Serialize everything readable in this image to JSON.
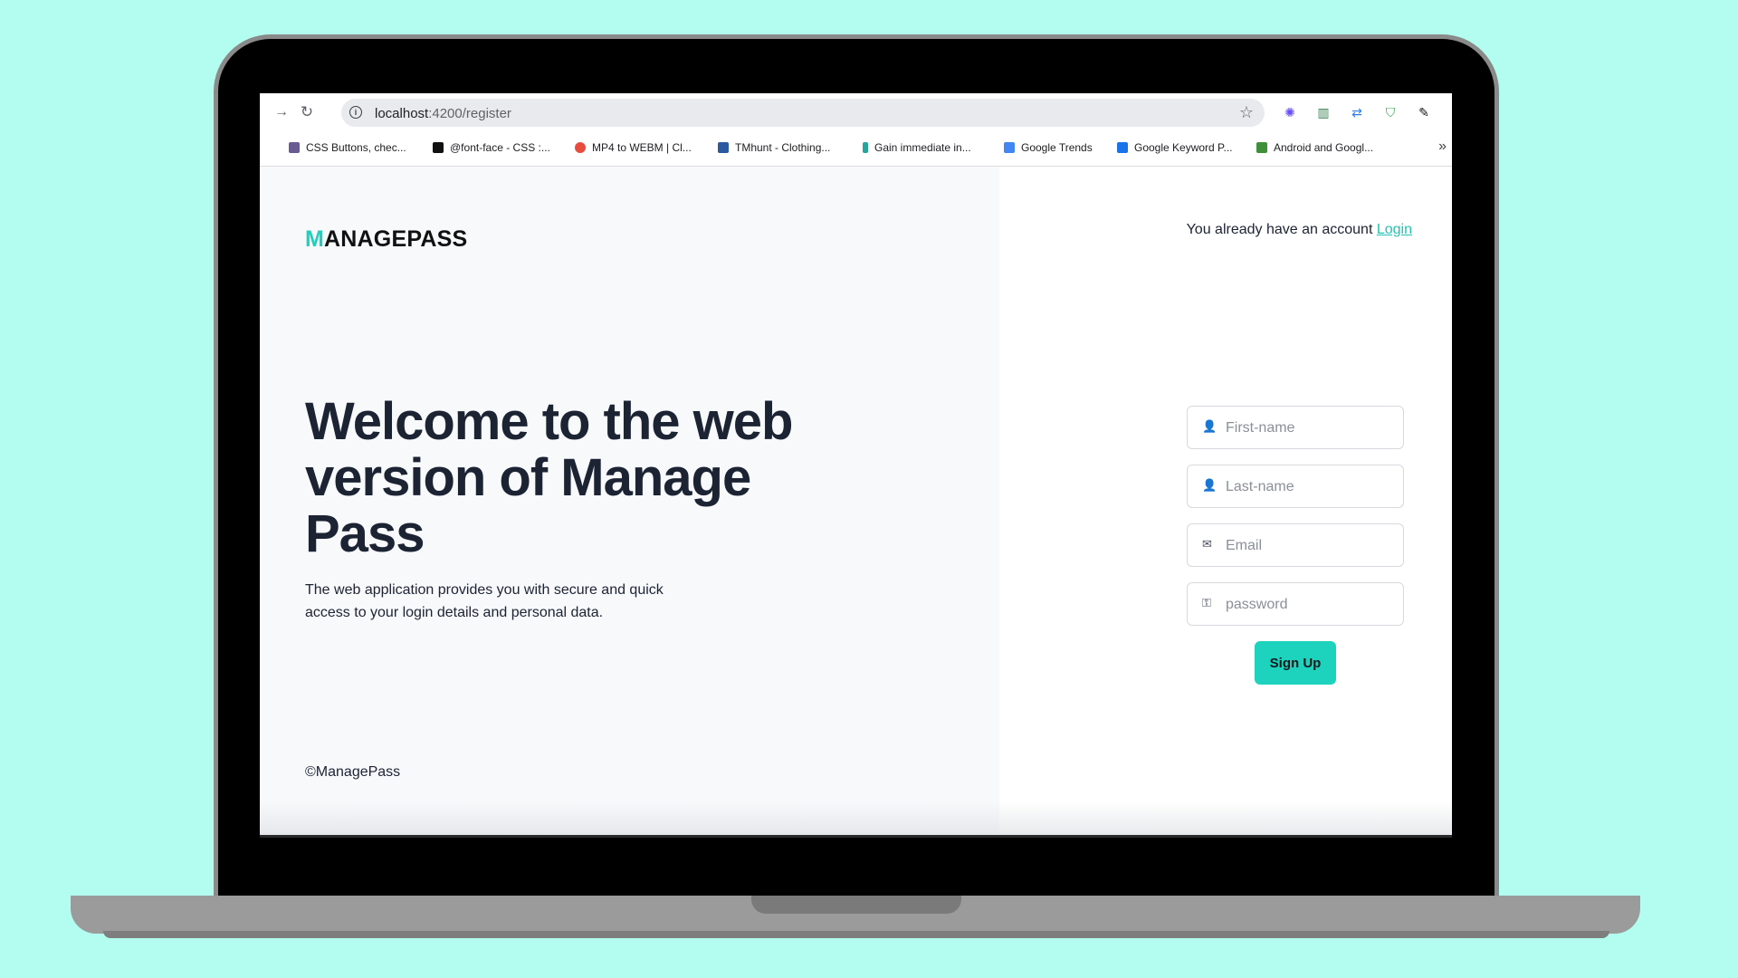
{
  "browser": {
    "url_host": "localhost",
    "url_rest": ":4200/register",
    "bookmarks": [
      "CSS Buttons, chec...",
      "@font-face - CSS :...",
      "MP4 to WEBM | Cl...",
      "TMhunt - Clothing...",
      "Gain immediate in...",
      "Google Trends",
      "Google Keyword P...",
      "Android and Googl..."
    ]
  },
  "page": {
    "logo_first": "M",
    "logo_rest": "ANAGEPASS",
    "headline": "Welcome to the web version of Manage Pass",
    "subtext": "The web application provides you with secure and quick access to your login details and personal data.",
    "copyright": "©ManagePass",
    "account_text": "You already have an account",
    "login_link": "Login"
  },
  "form": {
    "first_name_placeholder": "First-name",
    "last_name_placeholder": "Last-name",
    "email_placeholder": "Email",
    "password_placeholder": "password",
    "submit_label": "Sign Up"
  },
  "colors": {
    "accent": "#1ed3bd",
    "background": "#b2fdef",
    "heading": "#1c2333"
  }
}
